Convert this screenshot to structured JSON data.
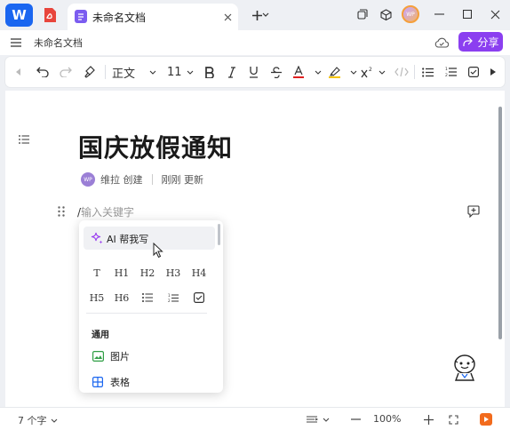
{
  "titlebar": {
    "app_logo_text": "W",
    "tab_title": "未命名文档",
    "user_avatar_text": "WP"
  },
  "subheader": {
    "doc_name": "未命名文档",
    "share_label": "分享"
  },
  "toolbar": {
    "style_label": "正文",
    "font_size": "11"
  },
  "document": {
    "title": "国庆放假通知",
    "author_avatar_text": "WP",
    "author_action": "维拉 创建",
    "updated_text": "刚刚 更新",
    "input_prefix": "/",
    "input_placeholder": "输入关键字"
  },
  "slash_menu": {
    "ai_label": "AI 帮我写",
    "heading_row1": [
      "T",
      "H1",
      "H2",
      "H3",
      "H4"
    ],
    "heading_row2": [
      "H5",
      "H6"
    ],
    "section_general": "通用",
    "items": [
      {
        "label": "图片",
        "icon": "image-icon"
      },
      {
        "label": "表格",
        "icon": "table-icon"
      }
    ]
  },
  "statusbar": {
    "word_count": "7 个字",
    "zoom_level": "100%"
  },
  "colors": {
    "brand_blue": "#1a66f0",
    "share_purple": "#8b3ff0",
    "doc_icon_purple": "#7b5cf0"
  }
}
